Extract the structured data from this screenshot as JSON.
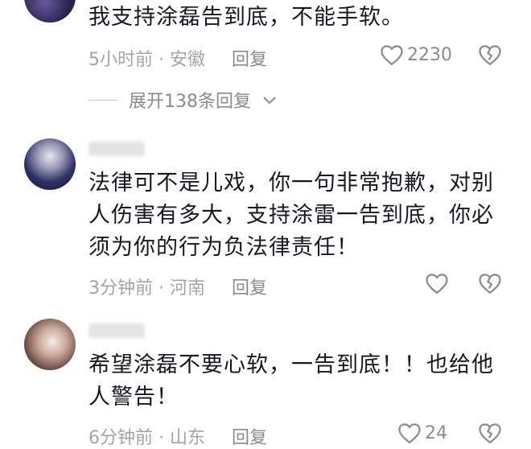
{
  "comments": [
    {
      "text": "我支持涂磊告到底，不能手软。",
      "time": "5小时前",
      "location": "安徽",
      "reply_label": "回复",
      "likes": "2230",
      "expand_label": "展开138条回复"
    },
    {
      "text": "法律可不是儿戏，你一句非常抱歉，对别人伤害有多大，支持涂雷一告到底，你必须为你的行为负法律责任！",
      "time": "3分钟前",
      "location": "河南",
      "reply_label": "回复",
      "likes": ""
    },
    {
      "text": "希望涂磊不要心软，一告到底！！也给他人警告！",
      "time": "6分钟前",
      "location": "山东",
      "reply_label": "回复",
      "likes": "24"
    }
  ],
  "meta_separator": " · ",
  "colors": {
    "meta": "#a3a3a8",
    "text": "#161823",
    "icon": "#8a8a90"
  },
  "icons": {
    "like": "heart-outline-icon",
    "dislike": "broken-heart-icon",
    "expand": "chevron-down-icon"
  }
}
